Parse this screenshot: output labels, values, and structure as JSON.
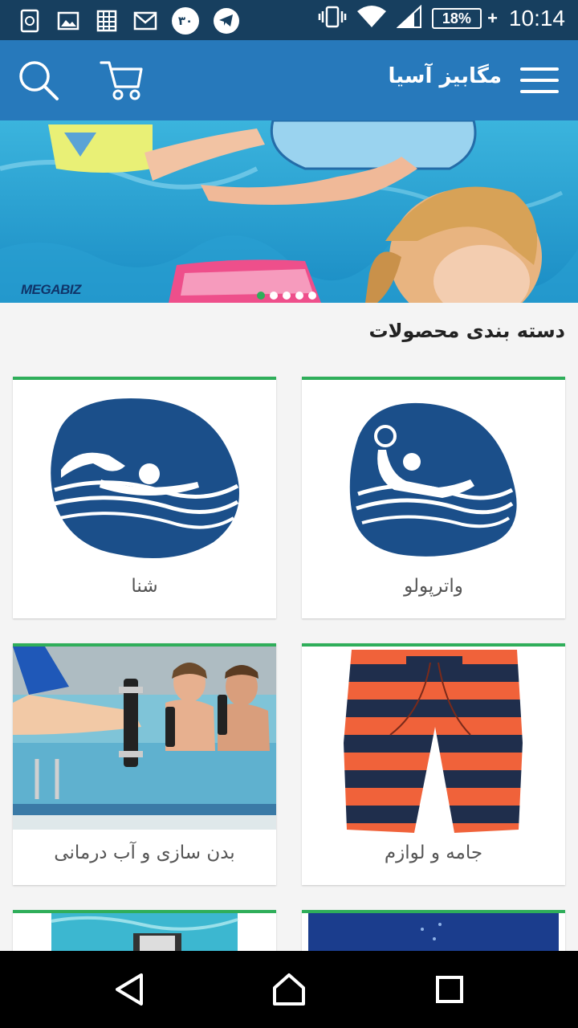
{
  "status_bar": {
    "battery": "18%",
    "time": "10:14",
    "notification_badge": "۳۰"
  },
  "app_bar": {
    "title": "مگابیز آسیا"
  },
  "banner": {
    "logo_text": "MEGABIZ",
    "slide_count": 6,
    "active_slide": 1
  },
  "section": {
    "title": "دسته بندی محصولات"
  },
  "categories": [
    {
      "label": "واترپولو",
      "icon": "water-polo-icon"
    },
    {
      "label": "شنا",
      "icon": "swimming-icon"
    },
    {
      "label": "جامه و لوازم",
      "icon": "swim-shorts-image"
    },
    {
      "label": "بدن سازی و آب درمانی",
      "icon": "aqua-fitness-image"
    }
  ],
  "colors": {
    "status_bar": "#173f5f",
    "app_bar": "#2779bb",
    "accent_green": "#2fae5a",
    "sport_icon_blue": "#1b4f8a"
  }
}
